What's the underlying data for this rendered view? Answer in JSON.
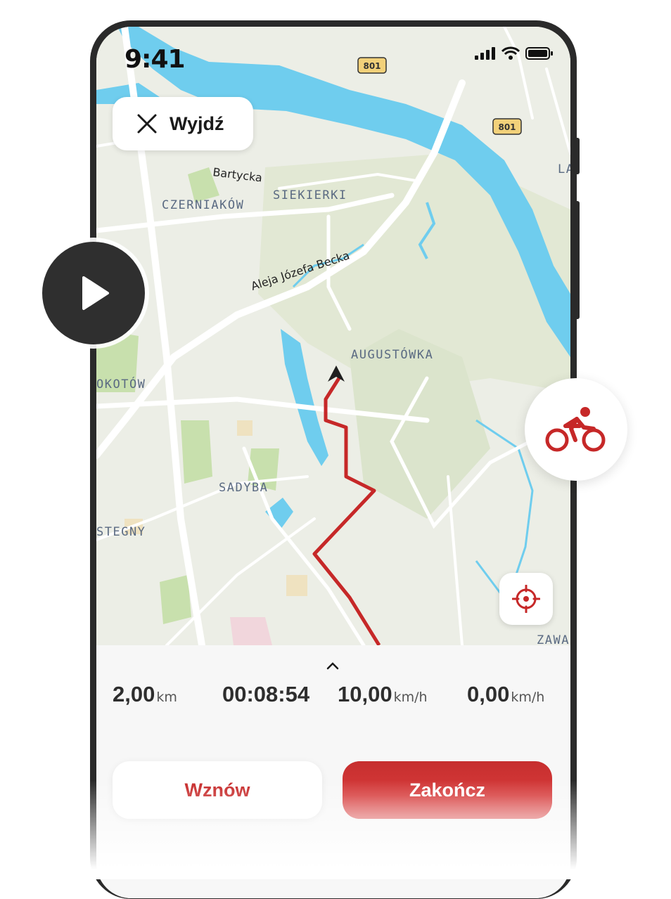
{
  "status_bar": {
    "time": "9:41"
  },
  "exit_button": {
    "label": "Wyjdź"
  },
  "map": {
    "districts": [
      "CZERNIAKÓW",
      "SIEKIERKI",
      "AUGUSTÓWKA",
      "OKOTÓW",
      "SADYBA",
      "STEGNY",
      "ZAWA",
      "LA"
    ],
    "roads": [
      "Bartycka",
      "Aleja Józefa Becka"
    ],
    "road_shields": [
      "801",
      "801"
    ],
    "colors": {
      "water": "#6fcdee",
      "route": "#c62828",
      "land": "#eceee6",
      "park": "#c8e0ad",
      "road": "#ffffff"
    }
  },
  "stats": {
    "distance": {
      "value": "2,00",
      "unit": "km"
    },
    "time": {
      "value": "00:08:54"
    },
    "speed": {
      "value": "10,00",
      "unit": "km/h"
    },
    "current_speed": {
      "value": "0,00",
      "unit": "km/h"
    }
  },
  "actions": {
    "resume": "Wznów",
    "finish": "Zakończ"
  },
  "icons": [
    "close-icon",
    "location-target-icon",
    "chevron-up-icon",
    "play-icon",
    "bicycle-icon",
    "signal-icon",
    "wifi-icon",
    "battery-icon"
  ],
  "accent_color": "#c62828"
}
